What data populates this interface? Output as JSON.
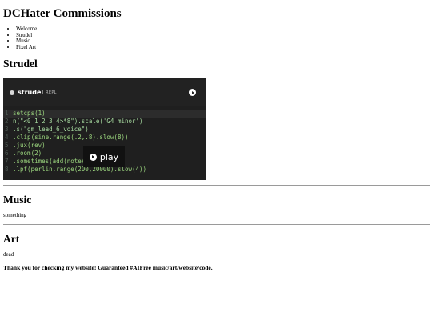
{
  "site": {
    "title": "DCHater Commissions"
  },
  "nav": {
    "items": [
      "Welcome",
      "Strudel",
      "Music",
      "Pixel Art"
    ]
  },
  "strudel": {
    "heading": "Strudel",
    "repl": {
      "brand": "strudel",
      "brand_sub": "REPL",
      "play_label": "play",
      "lines": [
        {
          "n": "1",
          "text": "setcps(1)"
        },
        {
          "n": "2",
          "text": "n(\"<0 1 2 3 4>*8\").scale('G4 minor')"
        },
        {
          "n": "3",
          "text": ".s(\"gm_lead_6_voice\")"
        },
        {
          "n": "4",
          "text": ".clip(sine.range(.2,.8).slow(8))"
        },
        {
          "n": "5",
          "text": ".jux(rev)"
        },
        {
          "n": "6",
          "text": ".room(2)"
        },
        {
          "n": "7",
          "text": ".sometimes(add(note(\"12\")))"
        },
        {
          "n": "8",
          "text": ".lpf(perlin.range(200,20000).slow(4))"
        }
      ]
    }
  },
  "music": {
    "heading": "Music",
    "text": "something"
  },
  "art": {
    "heading": "Art",
    "text": "dead"
  },
  "footer": {
    "text": "Thank you for checking my website! Guaranteed #AIFree music/art/website/code."
  },
  "colors": {
    "repl_bg": "#1f1f1f",
    "code_green": "#9bd67e",
    "code_orange": "#f6b36c"
  }
}
